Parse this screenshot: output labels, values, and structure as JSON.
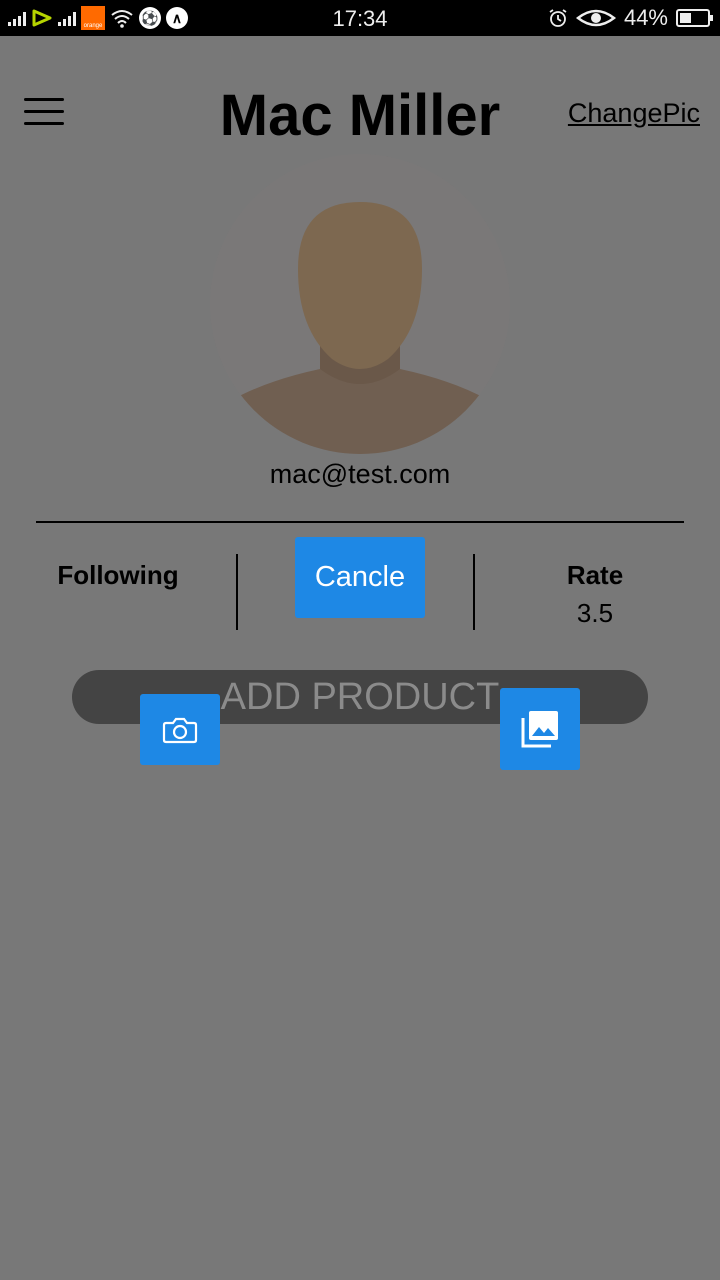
{
  "status_bar": {
    "time": "17:34",
    "battery": "44%",
    "battery_level": 0.44,
    "icons": [
      "signal-icon",
      "etisalat-icon",
      "orange-icon",
      "wifi-icon",
      "football-icon",
      "notification-icon",
      "alarm-icon",
      "eye-icon",
      "battery-icon"
    ],
    "orange_label": "orange"
  },
  "header": {
    "title": "Mac Miller",
    "change_pic": "ChangePic",
    "menu_icon": "hamburger-menu-icon"
  },
  "profile": {
    "email": "mac@test.com",
    "avatar_icon": "default-avatar-icon"
  },
  "stats": {
    "following_label": "Following",
    "rate_label": "Rate",
    "rate_value": "3.5"
  },
  "actions": {
    "cancel": "Cancle",
    "add_product": "ADD PRODUCT",
    "camera_icon": "camera-icon",
    "gallery_icon": "gallery-icon"
  },
  "colors": {
    "overlay_background": "#787878",
    "accent": "#1e88e5",
    "pill": "#444444"
  }
}
